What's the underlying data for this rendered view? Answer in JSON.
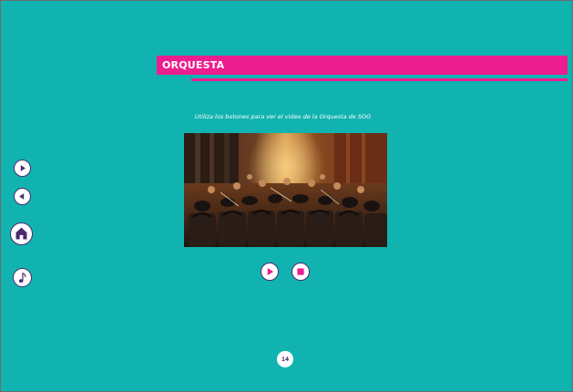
{
  "header": {
    "title": "ORQUESTA"
  },
  "content": {
    "instruction": "Utiliza los botones para  ver el video de la Orquesta  de SOG"
  },
  "nav": {
    "items": [
      {
        "icon": "play-right-icon"
      },
      {
        "icon": "play-left-icon"
      },
      {
        "icon": "home-icon"
      },
      {
        "icon": "music-note-icon"
      }
    ]
  },
  "controls": {
    "play_icon": "play-icon",
    "stop_icon": "stop-icon"
  },
  "footer": {
    "page_number": "14"
  },
  "colors": {
    "background": "#11b3b0",
    "accent": "#ec1d8e",
    "icon": "#4a2a6e"
  }
}
